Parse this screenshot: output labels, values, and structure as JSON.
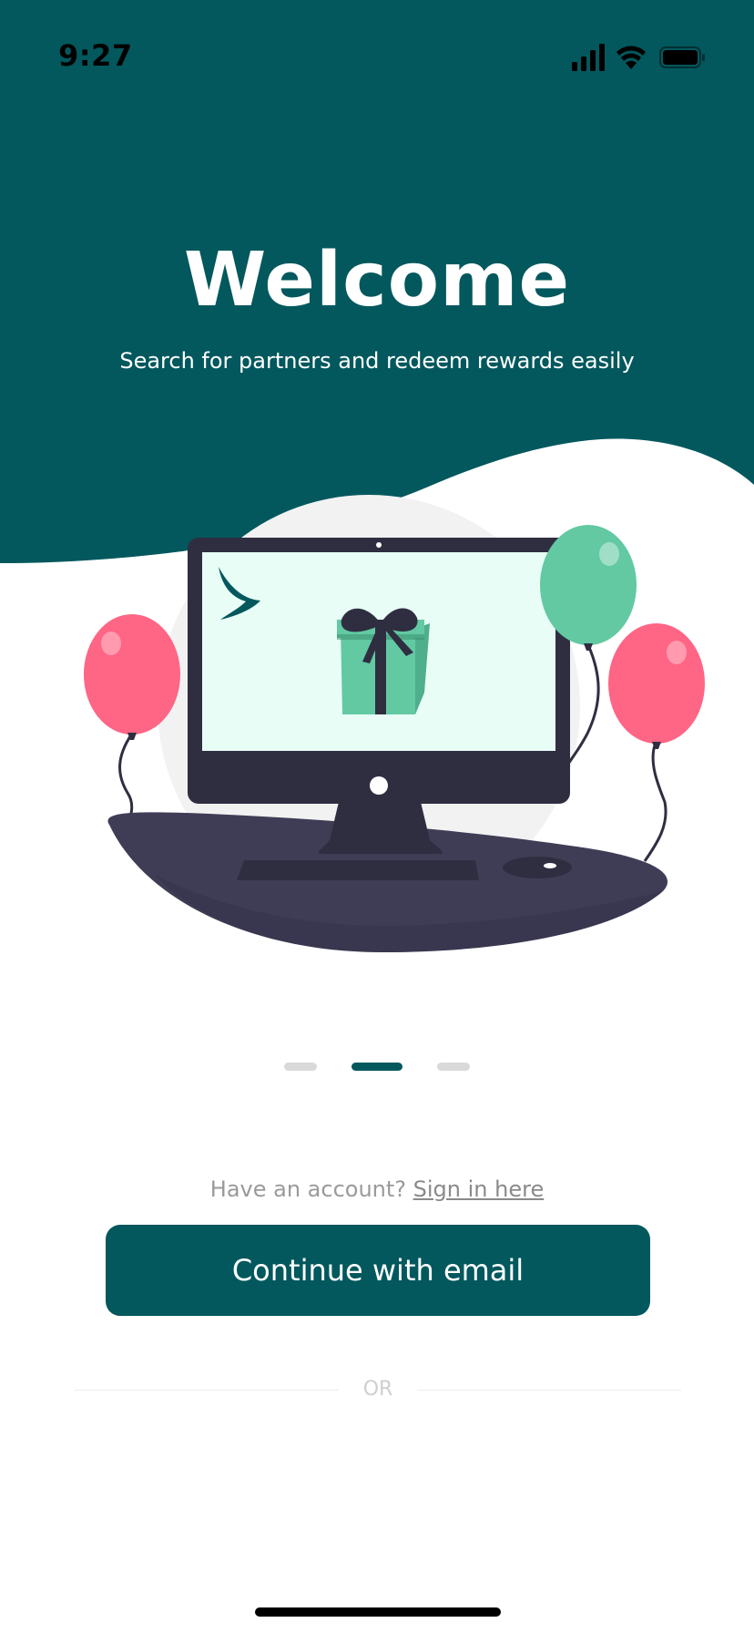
{
  "status_bar": {
    "time": "9:27",
    "icons": [
      "cellular-signal-icon",
      "wifi-icon",
      "battery-icon"
    ]
  },
  "hero": {
    "title": "Welcome",
    "subtitle": "Search for partners and redeem rewards easily"
  },
  "illustration": {
    "elements": [
      "desktop-monitor",
      "gift-box",
      "airline-logo",
      "balloon-pink-left",
      "balloon-green",
      "balloon-pink-right",
      "desk",
      "keyboard",
      "mouse"
    ]
  },
  "pager": {
    "total": 3,
    "active_index": 1
  },
  "account": {
    "prompt": "Have an account?",
    "link_label": "Sign in here"
  },
  "cta": {
    "label": "Continue with email"
  },
  "divider": {
    "label": "OR"
  },
  "colors": {
    "brand": "#02585d",
    "accent_green": "#62c9a3",
    "accent_pink": "#ff6584",
    "dark": "#2f2e41",
    "screen_bg": "#e8fdf6"
  }
}
